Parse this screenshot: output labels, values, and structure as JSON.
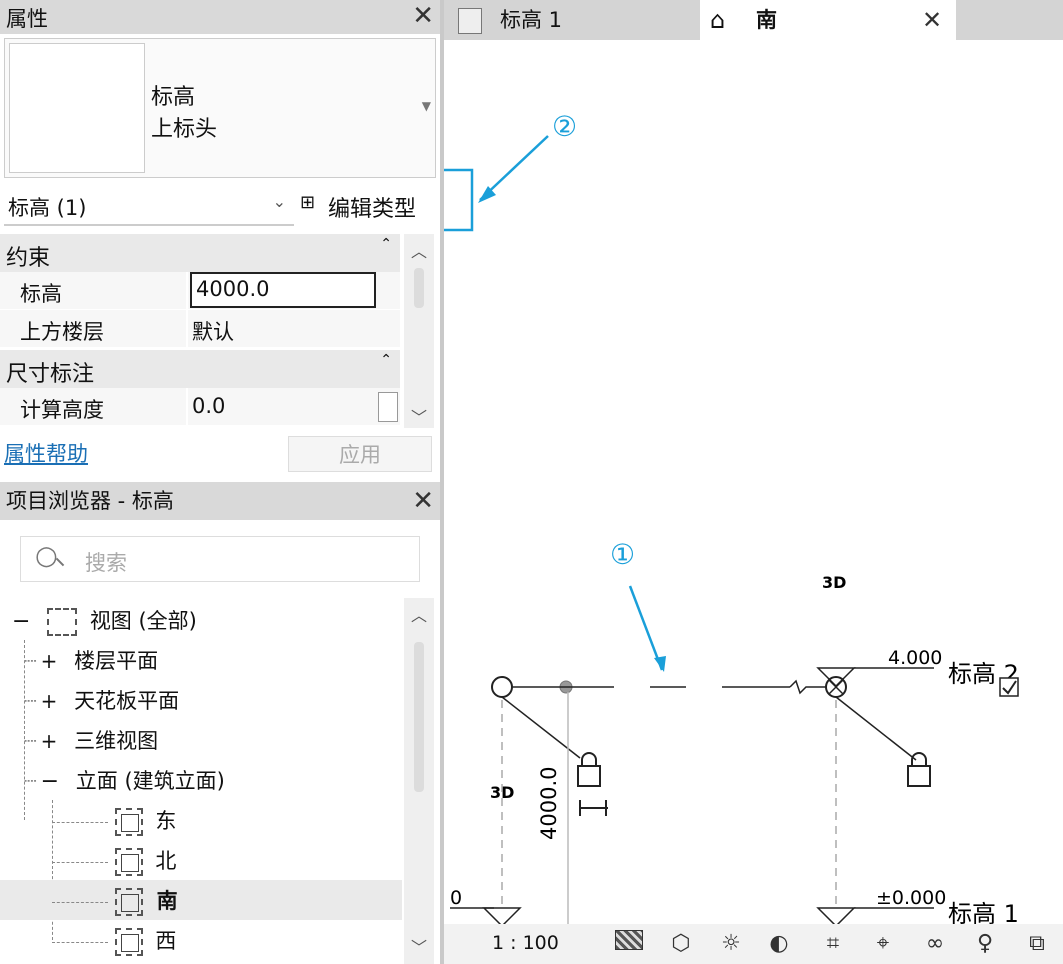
{
  "properties_panel": {
    "title": "属性",
    "type_preview": {
      "line1": "标高",
      "line2": "上标头"
    },
    "instance_selector": "标高 (1)",
    "edit_type_label": "编辑类型",
    "sections": [
      {
        "name": "约束",
        "rows": [
          {
            "key": "标高",
            "value": "4000.0"
          },
          {
            "key": "上方楼层",
            "value": "默认"
          }
        ]
      },
      {
        "name": "尺寸标注",
        "rows": [
          {
            "key": "计算高度",
            "value": "0.0"
          }
        ]
      }
    ],
    "help_link": "属性帮助",
    "apply_button": "应用"
  },
  "project_browser": {
    "title": "项目浏览器 - 标高",
    "search_placeholder": "搜索",
    "tree": {
      "root": "视图 (全部)",
      "items": [
        "楼层平面",
        "天花板平面",
        "三维视图",
        "立面 (建筑立面)"
      ],
      "elevations": [
        "东",
        "北",
        "南",
        "西"
      ],
      "selected": "南"
    }
  },
  "tabs": [
    {
      "label": "标高 1"
    },
    {
      "label": "南"
    }
  ],
  "canvas": {
    "callout_1": "①",
    "callout_2": "②",
    "label_3d_top": "3D",
    "label_3d_left": "3D",
    "level2": {
      "elevation": "4.000",
      "name": "标高 2"
    },
    "level1": {
      "elevation": "±0.000",
      "name": "标高 1"
    },
    "left_zero": "0",
    "dimension": "4000.0",
    "callout_color": "#1a9fd9"
  },
  "statusbar": {
    "scale": "1 : 100"
  }
}
